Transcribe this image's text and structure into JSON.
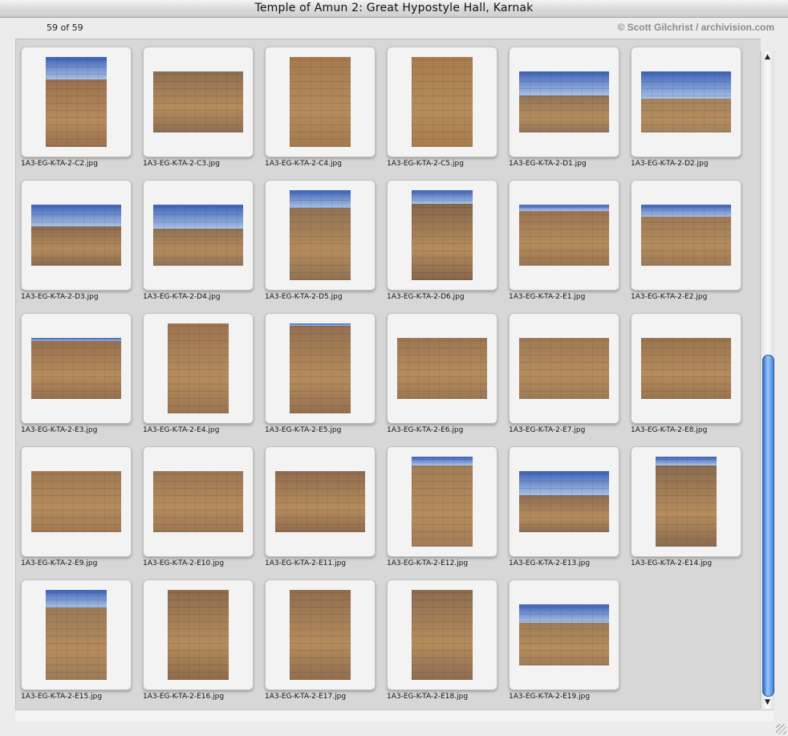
{
  "window": {
    "title": "Temple of Amun 2: Great Hypostyle Hall, Karnak",
    "count": "59 of 59",
    "credit": "© Scott Gilchrist / archivision.com"
  },
  "colors": {
    "stone": "#a17a52",
    "stone_light": "#b58c5d",
    "sky": "#4a72c2",
    "knob": "#4a8de8"
  },
  "thumbnails": [
    {
      "file": "1A3-EG-K-TA-2-C2.jpg",
      "orientation": "portrait",
      "sky": 0.25,
      "tint": "#9a7150"
    },
    {
      "file": "1A3-EG-K-TA-2-C3.jpg",
      "orientation": "landscape",
      "sky": 0,
      "tint": "#8e6d52"
    },
    {
      "file": "1A3-EG-K-TA-2-C4.jpg",
      "orientation": "portrait",
      "sky": 0,
      "tint": "#a47a4f"
    },
    {
      "file": "1A3-EG-K-TA-2-C5.jpg",
      "orientation": "portrait",
      "sky": 0,
      "tint": "#a97c4d"
    },
    {
      "file": "1A3-EG-K-TA-2-D1.jpg",
      "orientation": "landscape",
      "sky": 0.4,
      "tint": "#8f7458"
    },
    {
      "file": "1A3-EG-K-TA-2-D2.jpg",
      "orientation": "landscape",
      "sky": 0.45,
      "tint": "#a3835e"
    },
    {
      "file": "1A3-EG-K-TA-2-D3.jpg",
      "orientation": "landscape",
      "sky": 0.35,
      "tint": "#8a6a4e"
    },
    {
      "file": "1A3-EG-K-TA-2-D4.jpg",
      "orientation": "landscape",
      "sky": 0.4,
      "tint": "#8e7257"
    },
    {
      "file": "1A3-EG-K-TA-2-D5.jpg",
      "orientation": "portrait",
      "sky": 0.2,
      "tint": "#8f7254"
    },
    {
      "file": "1A3-EG-K-TA-2-D6.jpg",
      "orientation": "portrait",
      "sky": 0.15,
      "tint": "#85664b"
    },
    {
      "file": "1A3-EG-K-TA-2-E1.jpg",
      "orientation": "landscape",
      "sky": 0.1,
      "tint": "#9a7453"
    },
    {
      "file": "1A3-EG-K-TA-2-E2.jpg",
      "orientation": "landscape",
      "sky": 0.2,
      "tint": "#9d7957"
    },
    {
      "file": "1A3-EG-K-TA-2-E3.jpg",
      "orientation": "landscape",
      "sky": 0.05,
      "tint": "#96704f"
    },
    {
      "file": "1A3-EG-K-TA-2-E4.jpg",
      "orientation": "portrait",
      "sky": 0,
      "tint": "#9a7452"
    },
    {
      "file": "1A3-EG-K-TA-2-E5.jpg",
      "orientation": "portrait",
      "sky": 0.03,
      "tint": "#947052"
    },
    {
      "file": "1A3-EG-K-TA-2-E6.jpg",
      "orientation": "landscape",
      "sky": 0,
      "tint": "#9c7754"
    },
    {
      "file": "1A3-EG-K-TA-2-E7.jpg",
      "orientation": "landscape",
      "sky": 0,
      "tint": "#9e7a56"
    },
    {
      "file": "1A3-EG-K-TA-2-E8.jpg",
      "orientation": "landscape",
      "sky": 0,
      "tint": "#98744f"
    },
    {
      "file": "1A3-EG-K-TA-2-E9.jpg",
      "orientation": "landscape",
      "sky": 0,
      "tint": "#a07852"
    },
    {
      "file": "1A3-EG-K-TA-2-E10.jpg",
      "orientation": "landscape",
      "sky": 0,
      "tint": "#9b7654"
    },
    {
      "file": "1A3-EG-K-TA-2-E11.jpg",
      "orientation": "landscape",
      "sky": 0,
      "tint": "#8f6c4e"
    },
    {
      "file": "1A3-EG-K-TA-2-E12.jpg",
      "orientation": "portrait",
      "sky": 0.1,
      "tint": "#a27c57"
    },
    {
      "file": "1A3-EG-K-TA-2-E13.jpg",
      "orientation": "landscape",
      "sky": 0.4,
      "tint": "#8d6c52"
    },
    {
      "file": "1A3-EG-K-TA-2-E14.jpg",
      "orientation": "portrait",
      "sky": 0.1,
      "tint": "#8a6b50"
    },
    {
      "file": "1A3-EG-K-TA-2-E15.jpg",
      "orientation": "portrait",
      "sky": 0.2,
      "tint": "#9a7a58"
    },
    {
      "file": "1A3-EG-K-TA-2-E16.jpg",
      "orientation": "portrait",
      "sky": 0,
      "tint": "#8d6b4b"
    },
    {
      "file": "1A3-EG-K-TA-2-E17.jpg",
      "orientation": "portrait",
      "sky": 0,
      "tint": "#906d4f"
    },
    {
      "file": "1A3-EG-K-TA-2-E18.jpg",
      "orientation": "portrait",
      "sky": 0,
      "tint": "#8c6c52"
    },
    {
      "file": "1A3-EG-K-TA-2-E19.jpg",
      "orientation": "landscape",
      "sky": 0.3,
      "tint": "#9e7b58"
    }
  ],
  "scrollbar": {
    "position_fraction": 0.47,
    "visible_fraction": 0.53
  }
}
